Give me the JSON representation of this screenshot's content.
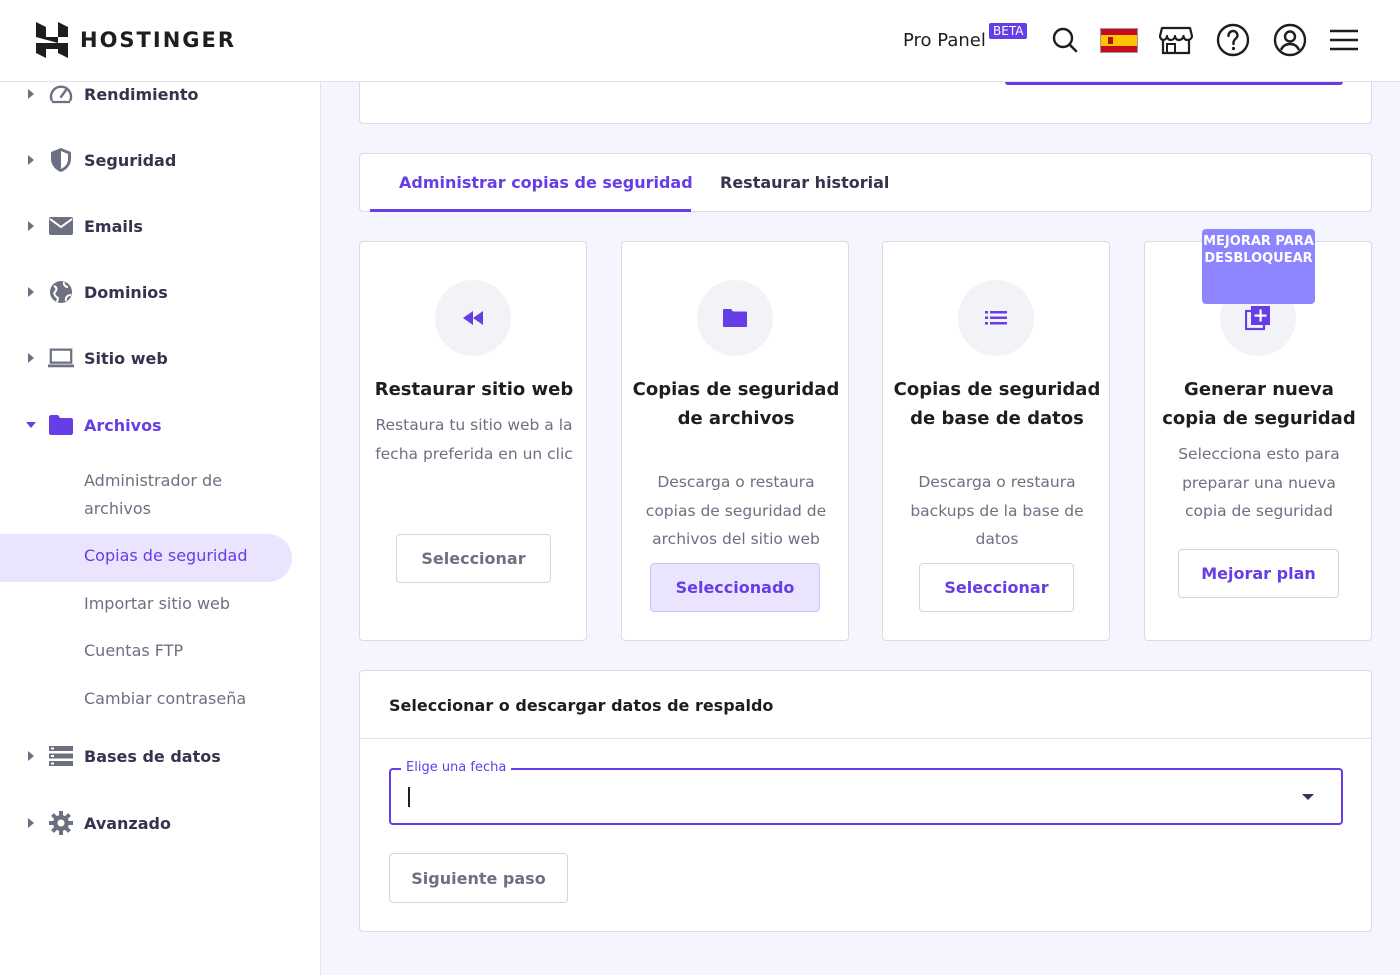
{
  "header": {
    "brand": "HOSTINGER",
    "pro_panel": "Pro Panel",
    "beta": "BETA",
    "icons": [
      "search-icon",
      "spain-flag-icon",
      "store-icon",
      "help-icon",
      "account-icon",
      "menu-icon"
    ]
  },
  "sidebar": {
    "items": [
      {
        "label": "Rendimiento",
        "icon": "gauge-icon"
      },
      {
        "label": "Seguridad",
        "icon": "shield-icon"
      },
      {
        "label": "Emails",
        "icon": "envelope-icon"
      },
      {
        "label": "Dominios",
        "icon": "globe-icon"
      },
      {
        "label": "Sitio web",
        "icon": "laptop-icon"
      },
      {
        "label": "Archivos",
        "icon": "folder-icon"
      },
      {
        "label": "Bases de datos",
        "icon": "database-icon"
      },
      {
        "label": "Avanzado",
        "icon": "gear-icon"
      }
    ],
    "archivos_sub": [
      "Administrador de archivos",
      "Copias de seguridad",
      "Importar sitio web",
      "Cuentas FTP",
      "Cambiar contraseña"
    ]
  },
  "tabs": [
    "Administrar copias de seguridad",
    "Restaurar historial"
  ],
  "options": [
    {
      "title": "Restaurar sitio web",
      "desc": "Restaura tu sitio web a la fecha preferida en un clic",
      "button": "Seleccionar",
      "icon": "rewind-icon"
    },
    {
      "title": "Copias de seguridad de archivos",
      "desc": "Descarga o restaura copias de seguridad de archivos del sitio web",
      "button": "Seleccionado",
      "icon": "folder-icon"
    },
    {
      "title": "Copias de seguridad de base de datos",
      "desc": "Descarga o restaura backups de la base de datos",
      "button": "Seleccionar",
      "icon": "list-icon"
    },
    {
      "title": "Generar nueva copia de seguridad",
      "desc": "Selecciona esto para preparar una nueva copia de seguridad",
      "button": "Mejorar plan",
      "icon": "add-copy-icon",
      "badge": "MEJORAR PARA DESBLOQUEAR"
    }
  ],
  "select_section": {
    "title": "Seleccionar o descargar datos de respaldo",
    "field_label": "Elige una fecha",
    "field_value": "",
    "next_button": "Siguiente paso"
  },
  "colors": {
    "accent": "#673de6",
    "accent_light": "#ebe4ff",
    "badge": "#8c85ff",
    "background": "#f4f5ff"
  }
}
